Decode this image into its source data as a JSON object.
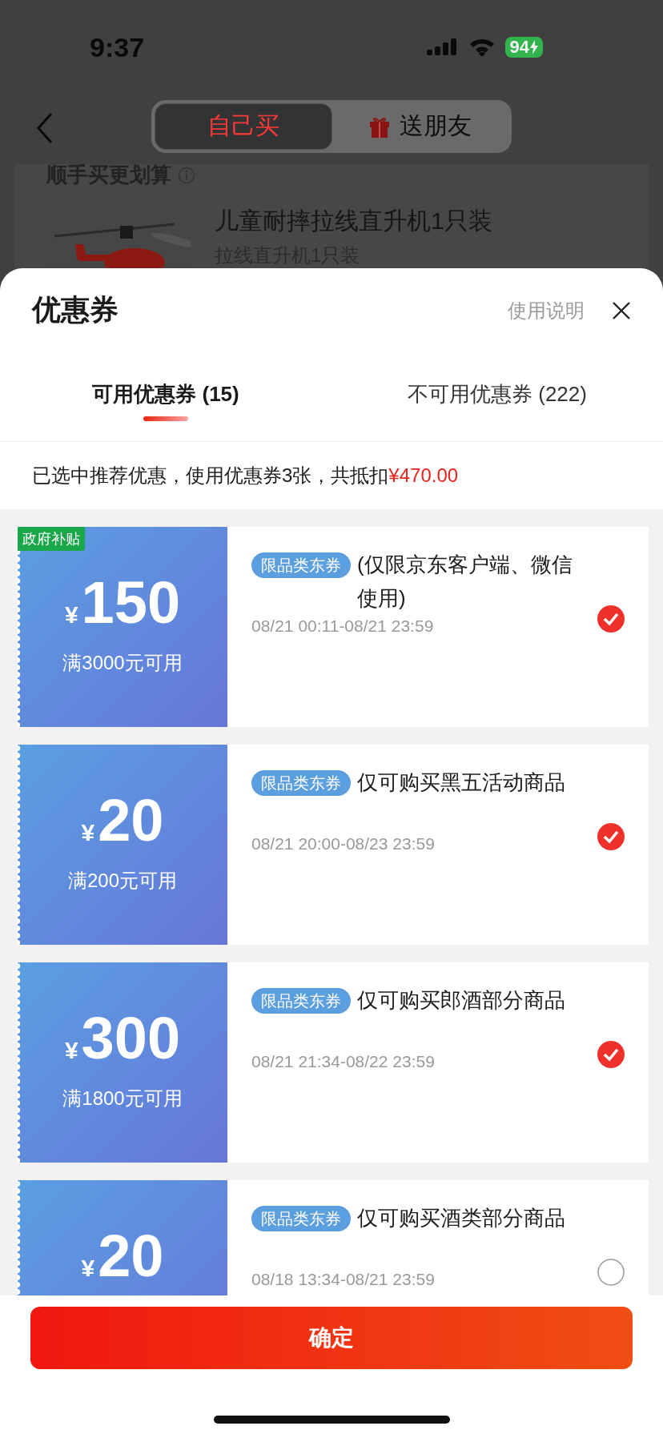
{
  "status_bar": {
    "time": "9:37",
    "battery": "94"
  },
  "nav": {
    "tabs": [
      {
        "label": "自己买",
        "selected": true
      },
      {
        "label": "送朋友",
        "selected": false
      }
    ]
  },
  "background": {
    "section_title": "顺手买更划算",
    "product": {
      "title": "儿童耐摔拉线直升机1只装",
      "subtitle": "拉线直升机1只装"
    }
  },
  "sheet": {
    "title": "优惠券",
    "help_link": "使用说明",
    "tabs": [
      {
        "label": "可用优惠券 (15)",
        "selected": true
      },
      {
        "label": "不可用优惠券 (222)",
        "selected": false
      }
    ],
    "summary": {
      "text": "已选中推荐优惠，使用优惠券3张，共抵扣",
      "amount": "¥470.00"
    },
    "coupons": [
      {
        "badge": "政府补贴",
        "currency": "¥",
        "amount": "150",
        "condition": "满3000元可用",
        "tag": "限品类东券",
        "title": "(仅限京东客户端、微信使用)",
        "validity": "08/21 00:11-08/21 23:59",
        "selected": true
      },
      {
        "currency": "¥",
        "amount": "20",
        "condition": "满200元可用",
        "tag": "限品类东券",
        "title": "仅可购买黑五活动商品",
        "validity": "08/21 20:00-08/23 23:59",
        "selected": true
      },
      {
        "currency": "¥",
        "amount": "300",
        "condition": "满1800元可用",
        "tag": "限品类东券",
        "title": "仅可购买郎酒部分商品",
        "validity": "08/21 21:34-08/22 23:59",
        "selected": true
      },
      {
        "currency": "¥",
        "amount": "20",
        "tag": "限品类东券",
        "title": "仅可购买酒类部分商品",
        "validity": "08/18 13:34-08/21 23:59",
        "selected": false
      }
    ],
    "confirm_button": "确定"
  }
}
